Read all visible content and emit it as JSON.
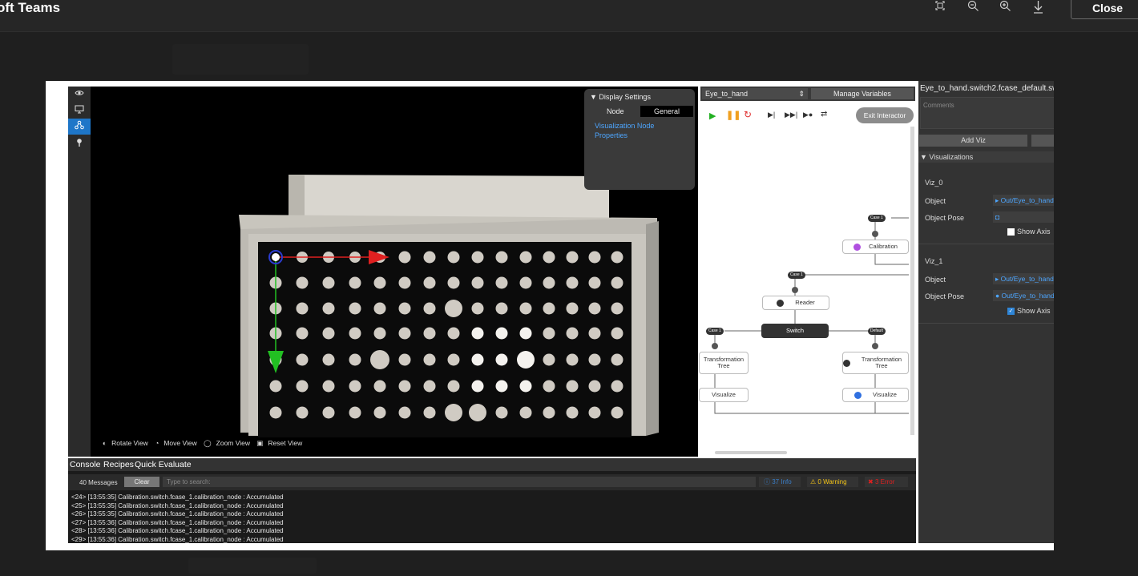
{
  "teams": {
    "title": "oft Teams",
    "close_label": "Close",
    "icons": [
      "fit-to-screen-icon",
      "zoom-out-icon",
      "zoom-in-icon",
      "download-icon"
    ]
  },
  "viewer": {
    "display_settings": {
      "header": "▼ Display Settings",
      "tab_node": "Node",
      "tab_general": "General",
      "link": "Visualization Node Properties"
    },
    "view_controls": [
      "Rotate View",
      "Move View",
      "Zoom View",
      "Reset View"
    ]
  },
  "graph": {
    "recipe_select": "Eye_to_hand",
    "manage_variables": "Manage Variables",
    "exit_interactor": "Exit Interactor",
    "nodes": {
      "calibration": "Calibration",
      "reader": "Reader",
      "switch": "Switch",
      "transform_left": "Transformation Tree",
      "transform_right": "Transformation Tree",
      "visualize_left": "Visualize",
      "visualize_right": "Visualize"
    },
    "pills": {
      "case1_top": "Case 1",
      "case1_mid": "Case 1",
      "case1_left": "Case 1",
      "default": "Default"
    }
  },
  "right_panel": {
    "filename": "Eye_to_hand.switch2.fcase_default.sw",
    "comments_placeholder": "Comments",
    "add_viz": "Add Viz",
    "visualizations_header": "▼ Visualizations",
    "viz0": {
      "name": "Viz_0",
      "object_label": "Object",
      "object_value": "Out/Eye_to_hand",
      "pose_label": "Object Pose",
      "show_axis": "Show Axis",
      "show_axis_checked": false
    },
    "viz1": {
      "name": "Viz_1",
      "object_label": "Object",
      "object_value": "Out/Eye_to_hand",
      "pose_label": "Object Pose",
      "pose_value": "Out/Eye_to_hand",
      "show_axis": "Show Axis",
      "show_axis_checked": true
    }
  },
  "console": {
    "tabs": [
      "Console",
      "Recipes",
      "Quick Evaluate"
    ],
    "message_count": "40 Messages",
    "clear": "Clear",
    "search_placeholder": "Type to search:",
    "info": "37 Info",
    "warning": "0 Warning",
    "error": "3 Error",
    "log": [
      "<24> [13:55:35] Calibration.switch.fcase_1.calibration_node : Accumulated",
      "<25> [13:55:35] Calibration.switch.fcase_1.calibration_node : Accumulated",
      "<26> [13:55:35] Calibration.switch.fcase_1.calibration_node : Accumulated",
      "<27> [13:55:36] Calibration.switch.fcase_1.calibration_node : Accumulated",
      "<28> [13:55:36] Calibration.switch.fcase_1.calibration_node : Accumulated",
      "<29> [13:55:36] Calibration.switch.fcase_1.calibration_node : Accumulated"
    ]
  },
  "colors": {
    "accent": "#0078d4",
    "info": "#4da6ff",
    "warning": "#f5c518",
    "error": "#e02020"
  }
}
